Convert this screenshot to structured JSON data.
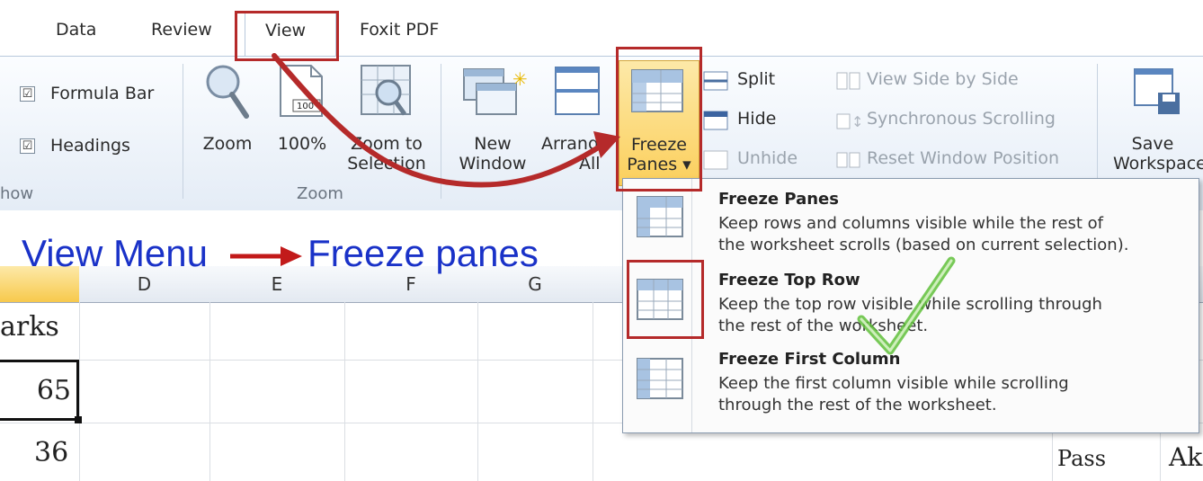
{
  "tabs": {
    "data": "Data",
    "review": "Review",
    "view": "View",
    "foxit": "Foxit PDF"
  },
  "show_group": {
    "formula_bar": "Formula Bar",
    "headings": "Headings",
    "label": "how",
    "formula_bar_checked": "☑",
    "headings_checked": "☑"
  },
  "zoom_group": {
    "zoom": "Zoom",
    "hundred": "100%",
    "zoom_to_l1": "Zoom to",
    "zoom_to_l2": "Selection",
    "label": "Zoom",
    "magnifier_badge": "100"
  },
  "window_group": {
    "new_l1": "New",
    "new_l2": "Window",
    "arrange_l1": "Arrange",
    "arrange_l2": "All",
    "freeze_l1": "Freeze",
    "freeze_l2": "Panes ▾",
    "split": "Split",
    "hide": "Hide",
    "unhide": "Unhide",
    "side_by_side": "View Side by Side",
    "sync_scroll": "Synchronous Scrolling",
    "reset_pos": "Reset Window Position",
    "save_l1": "Save",
    "save_l2": "Workspace"
  },
  "annotation": {
    "view_menu": "View Menu",
    "freeze_panes": "Freeze panes"
  },
  "sheet": {
    "columns": [
      "D",
      "E",
      "F",
      "G"
    ],
    "cells": {
      "marks_header": "arks",
      "v1": "65",
      "v2": "36",
      "pass": "Pass",
      "ak": "Ak"
    }
  },
  "dropdown": {
    "items": [
      {
        "title": "Freeze Panes",
        "desc_l1": "Keep rows and columns visible while the rest of",
        "desc_l2": "the worksheet scrolls (based on current selection)."
      },
      {
        "title": "Freeze Top Row",
        "desc_l1": "Keep the top row visible while scrolling through",
        "desc_l2": "the rest of the worksheet."
      },
      {
        "title": "Freeze First Column",
        "desc_l1": "Keep the first column visible while scrolling",
        "desc_l2": "through the rest of the worksheet."
      }
    ]
  },
  "colors": {
    "annotation_blue": "#1a32c8",
    "highlight_red": "#b52a2a",
    "freeze_highlight": "#fbd46a"
  }
}
